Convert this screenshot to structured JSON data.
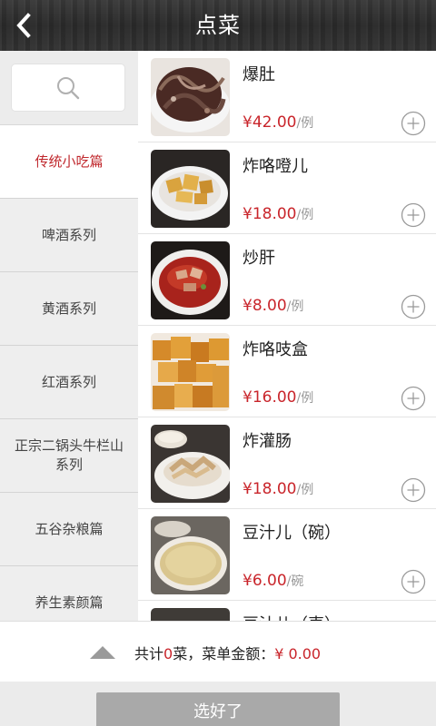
{
  "header": {
    "title": "点菜",
    "back_icon": "chevron-left-icon"
  },
  "sidebar": {
    "search_icon": "search-icon",
    "categories": [
      {
        "label": "传统小吃篇",
        "active": true
      },
      {
        "label": "啤酒系列",
        "active": false
      },
      {
        "label": "黄酒系列",
        "active": false
      },
      {
        "label": "红酒系列",
        "active": false
      },
      {
        "label": "正宗二锅头牛栏山系列",
        "active": false
      },
      {
        "label": "五谷杂粮篇",
        "active": false
      },
      {
        "label": "养生素颜篇",
        "active": false
      }
    ]
  },
  "dishes": [
    {
      "name": "爆肚",
      "price": "¥42.00",
      "unit": "/例"
    },
    {
      "name": "炸咯噔儿",
      "price": "¥18.00",
      "unit": "/例"
    },
    {
      "name": "炒肝",
      "price": "¥8.00",
      "unit": "/例"
    },
    {
      "name": "炸咯吱盒",
      "price": "¥16.00",
      "unit": "/例"
    },
    {
      "name": "炸灌肠",
      "price": "¥18.00",
      "unit": "/例"
    },
    {
      "name": "豆汁儿（碗）",
      "price": "¥6.00",
      "unit": "/碗"
    },
    {
      "name": "豆汁儿（壶）",
      "price": "",
      "unit": ""
    }
  ],
  "footer": {
    "prefix": "共计",
    "count": "0",
    "middle": "菜，菜单金额：",
    "amount": "¥ 0.00",
    "confirm_label": "选好了"
  },
  "colors": {
    "accent": "#c9252b",
    "header_bg": "#2e2e2e",
    "sidebar_bg": "#eeeeee",
    "confirm_bg": "#a9a9a9"
  }
}
